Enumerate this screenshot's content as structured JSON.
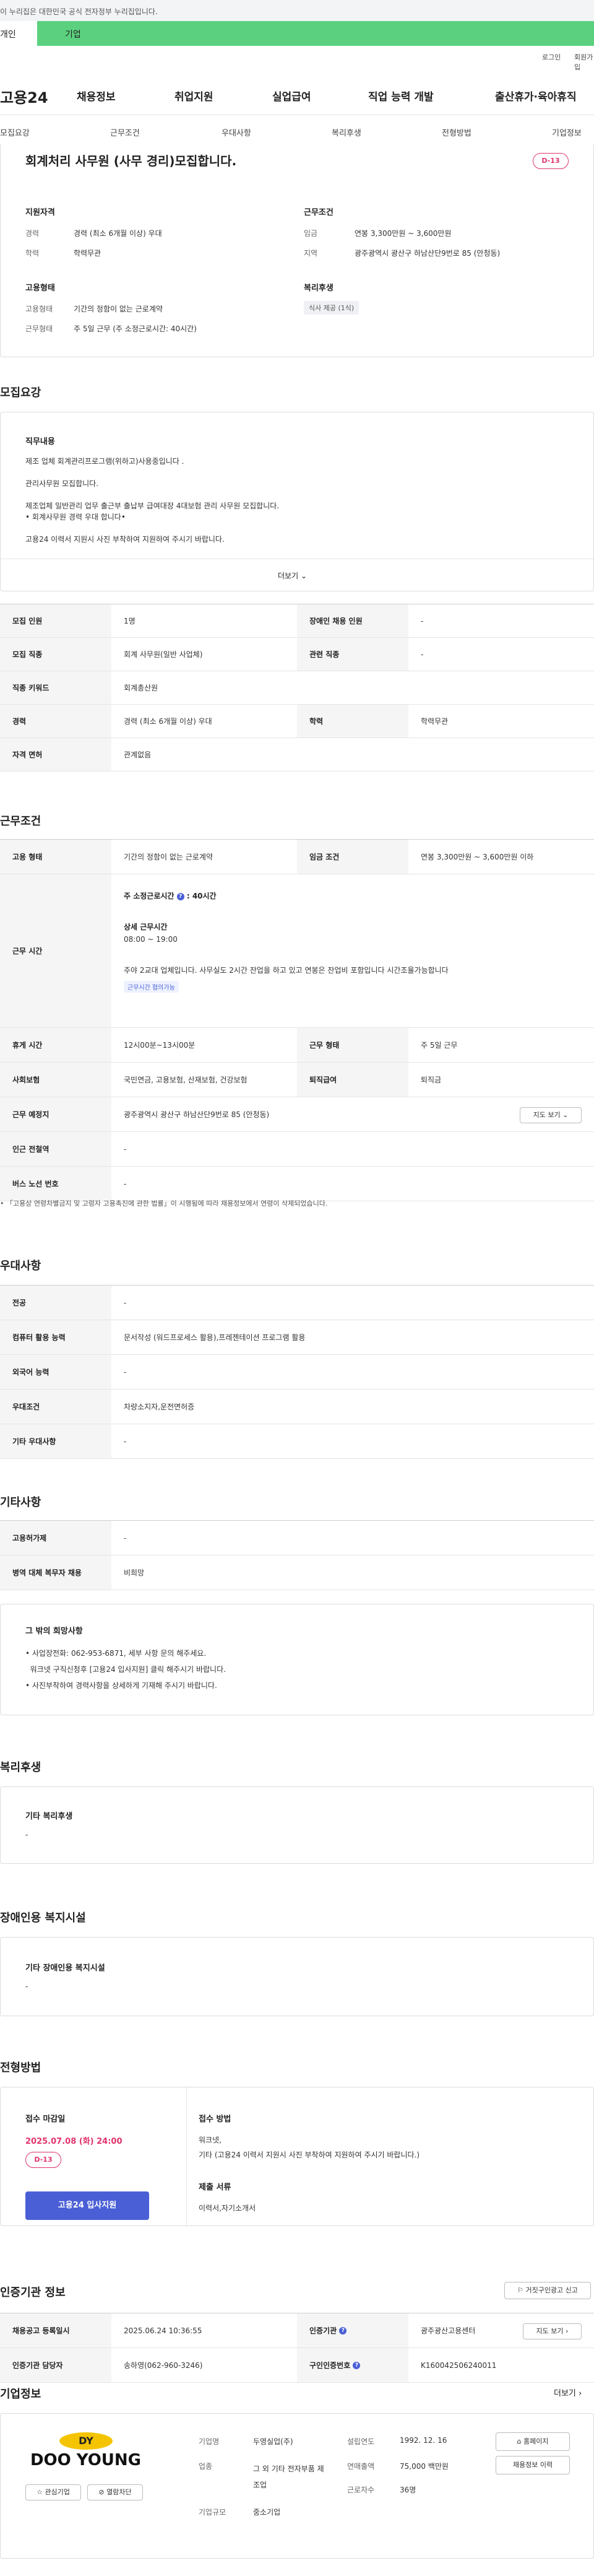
{
  "gov_banner": "이 누리집은 대한민국 공식 전자정부 누리집입니다.",
  "top_tabs": [
    "개인",
    "기업"
  ],
  "util": {
    "login": "로그인",
    "signup": "회원가입"
  },
  "nav": {
    "logo": "고용24",
    "items": [
      "채용정보",
      "취업지원",
      "실업급여",
      "직업 능력 개발",
      "출산휴가·육아휴직"
    ]
  },
  "subnav": [
    "모집요강",
    "근무조건",
    "우대사항",
    "복리후생",
    "전형방법",
    "기업정보"
  ],
  "header": {
    "title": "회계처리 사무원 (사무 경리)모집합니다.",
    "dday": "D-13",
    "qual_title": "지원자격",
    "career_label": "경력",
    "career_value": "경력 (최소 6개월 이상) 우대",
    "edu_label": "학력",
    "edu_value": "학력무관",
    "cond_title": "근무조건",
    "wage_label": "임금",
    "wage_value": "연봉 3,300만원 ~ 3,600만원",
    "region_label": "지역",
    "region_value": "광주광역시 광산구 하남산단9번로 85 (안청동)",
    "emp_title": "고용형태",
    "emptype_label": "고용형태",
    "emptype_value": "기간의 정함이 없는 근로계약",
    "worktype_label": "근무형태",
    "worktype_value": "주 5일 근무 (주 소정근로시간: 40시간)",
    "welfare_title": "복리후생",
    "welfare_chip": "식사 제공 (1식)"
  },
  "recruit": {
    "section_title": "모집요강",
    "job_title": "직무내용",
    "lines": [
      "제조 업체 회계관리프로그램(위하고)사용중입니다 .",
      "관리사무원 모집합니다.",
      "제조업체 일반관리 업무 출근부 출납부 급여대장 4대보험 관리 사무원 모집합니다.",
      "• 회계사무원 경력 우대 합니다•",
      "고용24 이력서 지원시 사진 부착하여 지원하여 주시기 바랍니다."
    ],
    "more": "더보기",
    "rows": [
      {
        "l1": "모집 인원",
        "v1": "1명",
        "l2": "장애인 채용 인원",
        "v2": "-"
      },
      {
        "l1": "모집 직종",
        "v1": "회계 사무원(일반 사업체)",
        "l2": "관련 직종",
        "v2": "-"
      },
      {
        "l1": "직종 키워드",
        "v1": "회계총산원"
      },
      {
        "l1": "경력",
        "v1": "경력 (최소 6개월 이상) 우대",
        "l2": "학력",
        "v2": "학력무관"
      },
      {
        "l1": "자격 면허",
        "v1": "관계없음"
      }
    ]
  },
  "work": {
    "section_title": "근무조건",
    "emp_label": "고용 형태",
    "emp_value": "기간의 정함이 없는 근로계약",
    "wage_label": "임금 조건",
    "wage_value": "연봉 3,300만원 ~ 3,600만원 이하",
    "time_label": "근무 시간",
    "weekly": "주 소정근로시간",
    "weekly_hours": "40시간",
    "detail_title": "상세 근무시간",
    "detail_time": "08:00 ~ 19:00",
    "detail_note": "주야 2교대 업체입니다.  사무실도 2시간 잔업을 하고 있고 연봉은 잔업비 포함입니다  시간조율가능합니다",
    "flex_chip": "근무시간 협의가능",
    "rest_label": "휴게 시간",
    "rest_value": "12시00분~13시00분",
    "form_label": "근무 형태",
    "form_value": "주 5일 근무",
    "ins_label": "사회보험",
    "ins_value": "국민연금, 고용보험, 산재보험, 건강보험",
    "sev_label": "퇴직급여",
    "sev_value": "퇴직금",
    "place_label": "근무 예정지",
    "place_value": "광주광역시 광산구 하남산단9번로 85 (안청동)",
    "map_btn": "지도 보기",
    "station_label": "인근 전철역",
    "station_value": "-",
    "bus_label": "버스 노선 번호",
    "bus_value": "-",
    "footnote": "「고용상 연령차별금지 및 고령자 고용촉진에 관한 법률」이 시행됨에 따라 채용정보에서 연령이 삭제되었습니다."
  },
  "pref": {
    "section_title": "우대사항",
    "rows": [
      {
        "l": "전공",
        "v": "-"
      },
      {
        "l": "컴퓨터 활용 능력",
        "v": "문서작성 (워드프로세스 활용),프레젠테이션 프로그램 활용"
      },
      {
        "l": "외국어 능력",
        "v": "-"
      },
      {
        "l": "우대조건",
        "v": "차량소지자,운전면허증"
      },
      {
        "l": "기타 우대사항",
        "v": "-"
      }
    ]
  },
  "etc": {
    "section_title": "기타사항",
    "rows": [
      {
        "l": "고용허가제",
        "v": "-"
      },
      {
        "l": "병역 대체 복무자 채용",
        "v": "비희망"
      }
    ],
    "box_title": "그 밖의 희망사항",
    "box_lines": [
      "• 사업장전화: 062-953-6871, 세부 사항 문의 해주세요.",
      "  워크넷 구직신청후 [고용24 입사지원] 클릭 해주시기 바랍니다.",
      "• 사진부착하여 경력사항을 상세하게 기재해 주시기 바랍니다."
    ]
  },
  "welfare": {
    "section_title": "복리후생",
    "box_title": "기타 복리후생",
    "box_value": "-"
  },
  "disabled": {
    "section_title": "장애인용 복지시설",
    "box_title": "기타 장애인용 복지시설",
    "box_value": "-"
  },
  "selection": {
    "section_title": "전형방법",
    "deadline_label": "접수 마감일",
    "deadline_value": "2025.07.08 (화) 24:00",
    "dday": "D-13",
    "apply_btn": "고용24 입사지원",
    "method_label": "접수 방법",
    "method_lines": [
      "워크넷,",
      "기타 (고용24 이력서 지원시 사진 부착하여 지원하여 주시기 바랍니다.)"
    ],
    "docs_label": "제출 서류",
    "docs_value": "이력서,자기소개서"
  },
  "cert": {
    "section_title": "인증기관 정보",
    "report_btn": "거짓구인광고 신고",
    "reg_label": "채용공고 등록일시",
    "reg_value": "2025.06.24 10:36:55",
    "org_label": "인증기관",
    "org_value": "광주광산고용센터",
    "map_btn": "지도 보기",
    "mgr_label": "인증기관 담당자",
    "mgr_value": "송하영(062-960-3246)",
    "no_label": "구인인증번호",
    "no_value": "K160042506240011"
  },
  "company": {
    "section_title": "기업정보",
    "more": "더보기",
    "logo_letters": "DY",
    "logo_text": "DOO YOUNG",
    "interest_btn": "관심기업",
    "block_btn": "열람차단",
    "name_label": "기업명",
    "name_value": "두영실업(주)",
    "industry_label": "업종",
    "industry_value": "그 외 기타 전자부품 제조업",
    "size_label": "기업규모",
    "size_value": "중소기업",
    "year_label": "설립연도",
    "year_value": "1992. 12. 16",
    "sales_label": "연매출액",
    "sales_value": "75,000 백만원",
    "staff_label": "근로자수",
    "staff_value": "36명",
    "home_btn": "홈페이지",
    "jobs_btn": "채용정보 이력"
  },
  "colors": {
    "green": "#5bd17f",
    "red": "#e2336b",
    "blue": "#4a5fd6"
  }
}
